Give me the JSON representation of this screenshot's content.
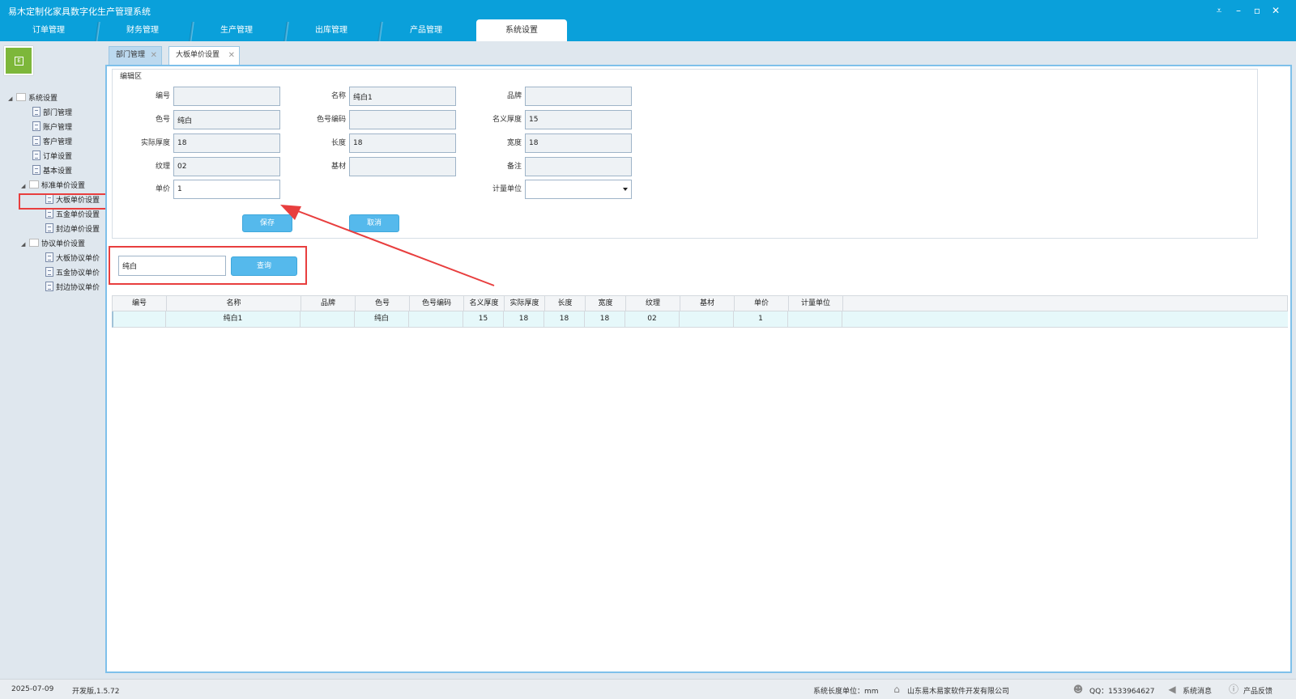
{
  "window": {
    "title": "易木定制化家具数字化生产管理系统"
  },
  "nav": {
    "tabs": [
      "订单管理",
      "财务管理",
      "生产管理",
      "出库管理",
      "产品管理",
      "系统设置"
    ],
    "active": "系统设置"
  },
  "logo": {
    "letter": "E"
  },
  "sidebar": {
    "root": "系统设置",
    "items": [
      "部门管理",
      "账户管理",
      "客户管理",
      "订单设置",
      "基本设置"
    ],
    "standard_group": "标准单价设置",
    "standard_items": [
      "大板单价设置",
      "五金单价设置",
      "封边单价设置"
    ],
    "agreement_group": "协议单价设置",
    "agreement_items": [
      "大板协议单价",
      "五金协议单价",
      "封边协议单价"
    ],
    "selected": "大板单价设置"
  },
  "content_tabs": [
    {
      "label": "部门管理",
      "close": "✕"
    },
    {
      "label": "大板单价设置",
      "close": "✕"
    }
  ],
  "edit": {
    "legend": "编辑区",
    "fields": {
      "code": {
        "label": "编号",
        "value": ""
      },
      "name": {
        "label": "名称",
        "value": "纯白1"
      },
      "brand": {
        "label": "品牌",
        "value": ""
      },
      "color": {
        "label": "色号",
        "value": "纯白"
      },
      "color_code": {
        "label": "色号编码",
        "value": ""
      },
      "nominal_thickness": {
        "label": "名义厚度",
        "value": "15"
      },
      "actual_thickness": {
        "label": "实际厚度",
        "value": "18"
      },
      "length": {
        "label": "长度",
        "value": "18"
      },
      "width": {
        "label": "宽度",
        "value": "18"
      },
      "texture": {
        "label": "纹理",
        "value": "02"
      },
      "base": {
        "label": "基材",
        "value": ""
      },
      "remark": {
        "label": "备注",
        "value": ""
      },
      "price": {
        "label": "单价",
        "value": "1"
      },
      "unit": {
        "label": "计量单位",
        "value": ""
      }
    },
    "save_label": "保存",
    "cancel_label": "取消"
  },
  "search": {
    "value": "纯白",
    "button_label": "查询"
  },
  "table": {
    "columns": [
      "编号",
      "名称",
      "品牌",
      "色号",
      "色号编码",
      "名义厚度",
      "实际厚度",
      "长度",
      "宽度",
      "纹理",
      "基材",
      "单价",
      "计量单位"
    ],
    "rows": [
      [
        "",
        "纯白1",
        "",
        "纯白",
        "",
        "15",
        "18",
        "18",
        "18",
        "02",
        "",
        "1",
        ""
      ]
    ]
  },
  "status": {
    "date": "2025-07-09",
    "version": "开发版,1.5.72",
    "length_unit": "系统长度单位：mm",
    "company": "山东易木易家软件开发有限公司",
    "qq": "QQ：1533964627",
    "messages": "系统消息",
    "feedback": "产品反馈"
  },
  "colors": {
    "accent": "#0aa0da",
    "button": "#55b9ec",
    "highlight": "#e83e3e"
  }
}
